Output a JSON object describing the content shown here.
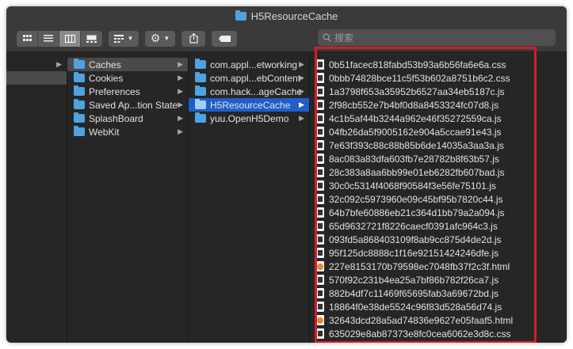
{
  "window": {
    "title": "H5ResourceCache"
  },
  "toolbar": {
    "search_placeholder": "搜索",
    "view_icons": [
      "grid-view-icon",
      "list-view-icon",
      "column-view-icon",
      "gallery-view-icon"
    ],
    "group_icon": "group-by-icon",
    "action_icon": "gear-icon",
    "share_icon": "share-icon",
    "tag_icon": "tag-icon"
  },
  "column2": [
    {
      "label": "Caches",
      "state": "gray"
    },
    {
      "label": "Cookies"
    },
    {
      "label": "Preferences"
    },
    {
      "label": "Saved Ap...tion State"
    },
    {
      "label": "SplashBoard"
    },
    {
      "label": "WebKit"
    }
  ],
  "column3": [
    {
      "label": "com.appl...etworking"
    },
    {
      "label": "com.appl...ebContent"
    },
    {
      "label": "com.hack...ageCache"
    },
    {
      "label": "H5ResourceCache",
      "state": "selected"
    },
    {
      "label": "yuu.OpenH5Demo"
    }
  ],
  "files": [
    {
      "name": "0b51facec818fabd53b93a6b56fa6e6a.css",
      "type": "doc"
    },
    {
      "name": "0bbb74828bce11c5f53b602a8751b6c2.css",
      "type": "doc"
    },
    {
      "name": "1a3798f653a35952b6527aa34eb5187c.js",
      "type": "doc"
    },
    {
      "name": "2f98cb552e7b4bf0d8a8453324fc07d8.js",
      "type": "doc"
    },
    {
      "name": "4c1b5af44b3244a962e46f35272559ca.js",
      "type": "doc"
    },
    {
      "name": "04fb26da5f9005162e904a5ccae91e43.js",
      "type": "doc"
    },
    {
      "name": "7e63f393c88c88b85b6de14035a3aa3a.js",
      "type": "doc"
    },
    {
      "name": "8ac083a83dfa603fb7e28782b8f63b57.js",
      "type": "doc"
    },
    {
      "name": "28c383a8aa6bb99e01eb6282fb607bad.js",
      "type": "doc"
    },
    {
      "name": "30c0c5314f4068f90584f3e56fe75101.js",
      "type": "doc"
    },
    {
      "name": "32c092c5973960e09c45bf95b7820c44.js",
      "type": "doc"
    },
    {
      "name": "64b7bfe60886eb21c364d1bb79a2a094.js",
      "type": "doc"
    },
    {
      "name": "65d9632721f8226caecf0391afc964c3.js",
      "type": "doc"
    },
    {
      "name": "093fd5a868403109f8ab9cc875d4de2d.js",
      "type": "doc"
    },
    {
      "name": "95f125dc8888c1f16e92151424246dfe.js",
      "type": "doc"
    },
    {
      "name": "227e8153170b79598ec7048fb37f2c3f.html",
      "type": "html"
    },
    {
      "name": "570f92c231b4ea25a7bf86b782f26ca7.js",
      "type": "doc"
    },
    {
      "name": "882b4df7c11469f65695fab3a69672bd.js",
      "type": "doc"
    },
    {
      "name": "18864f0e38de5524c96f83d528a56d74.js",
      "type": "doc"
    },
    {
      "name": "32643dcd28a5ad74836e9627e05faaf5.html",
      "type": "html"
    },
    {
      "name": "635029e8ab87373e8fc0cea6062e3d8c.css",
      "type": "doc"
    }
  ],
  "colors": {
    "selection": "#1f5ec9",
    "highlight_border": "#d0202a",
    "folder": "#4fa3e0"
  }
}
